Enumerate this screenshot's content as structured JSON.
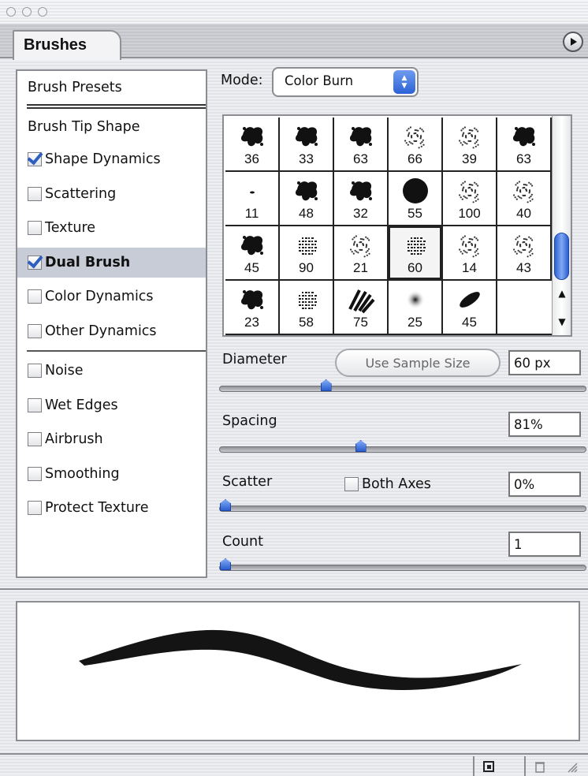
{
  "panel": {
    "tab_title": "Brushes"
  },
  "left_list": {
    "brush_presets": "Brush Presets",
    "brush_tip_shape": "Brush Tip Shape",
    "options": [
      {
        "label": "Shape Dynamics",
        "checked": true,
        "selected": false
      },
      {
        "label": "Scattering",
        "checked": false,
        "selected": false
      },
      {
        "label": "Texture",
        "checked": false,
        "selected": false
      },
      {
        "label": "Dual Brush",
        "checked": true,
        "selected": true
      },
      {
        "label": "Color Dynamics",
        "checked": false,
        "selected": false
      },
      {
        "label": "Other Dynamics",
        "checked": false,
        "selected": false
      }
    ],
    "extras": [
      {
        "label": "Noise",
        "checked": false
      },
      {
        "label": "Wet Edges",
        "checked": false
      },
      {
        "label": "Airbrush",
        "checked": false
      },
      {
        "label": "Smoothing",
        "checked": false
      },
      {
        "label": "Protect Texture",
        "checked": false
      }
    ]
  },
  "mode": {
    "label": "Mode:",
    "value": "Color Burn"
  },
  "presets": [
    {
      "size": "36",
      "icon": "splatter-brush-icon"
    },
    {
      "size": "33",
      "icon": "splatter-brush-icon"
    },
    {
      "size": "63",
      "icon": "splatter-brush-icon"
    },
    {
      "size": "66",
      "icon": "speckle-brush-icon"
    },
    {
      "size": "39",
      "icon": "speckle-brush-icon"
    },
    {
      "size": "63",
      "icon": "splatter-brush-icon"
    },
    {
      "size": "11",
      "icon": "small-dab-icon"
    },
    {
      "size": "48",
      "icon": "splatter-brush-icon"
    },
    {
      "size": "32",
      "icon": "splatter-brush-icon"
    },
    {
      "size": "55",
      "icon": "hard-round-icon"
    },
    {
      "size": "100",
      "icon": "speckle-brush-icon"
    },
    {
      "size": "40",
      "icon": "speckle-brush-icon"
    },
    {
      "size": "45",
      "icon": "splatter-brush-icon"
    },
    {
      "size": "90",
      "icon": "texture-brush-icon"
    },
    {
      "size": "21",
      "icon": "speckle-brush-icon"
    },
    {
      "size": "60",
      "icon": "texture-brush-icon",
      "selected": true
    },
    {
      "size": "14",
      "icon": "speckle-brush-icon"
    },
    {
      "size": "43",
      "icon": "speckle-brush-icon"
    },
    {
      "size": "23",
      "icon": "splatter-brush-icon"
    },
    {
      "size": "58",
      "icon": "texture-brush-icon"
    },
    {
      "size": "75",
      "icon": "grass-brush-icon"
    },
    {
      "size": "25",
      "icon": "soft-round-icon"
    },
    {
      "size": "45",
      "icon": "angled-ellipse-icon"
    },
    {
      "size": "",
      "icon": ""
    }
  ],
  "scroll": {
    "position": 0.55
  },
  "diameter": {
    "label": "Diameter",
    "button": "Use Sample Size",
    "value": "60 px",
    "slider": 0.29
  },
  "spacing": {
    "label": "Spacing",
    "value": "81%",
    "slider": 0.39
  },
  "scatter": {
    "label": "Scatter",
    "both_axes": "Both Axes",
    "both_axes_checked": false,
    "value": "0%",
    "slider": 0.0
  },
  "count": {
    "label": "Count",
    "value": "1",
    "slider": 0.0
  },
  "colors": {
    "accent": "#2c5fd0",
    "selected_row": "#c8ccd6",
    "panel_bg": "#e9eaee"
  }
}
